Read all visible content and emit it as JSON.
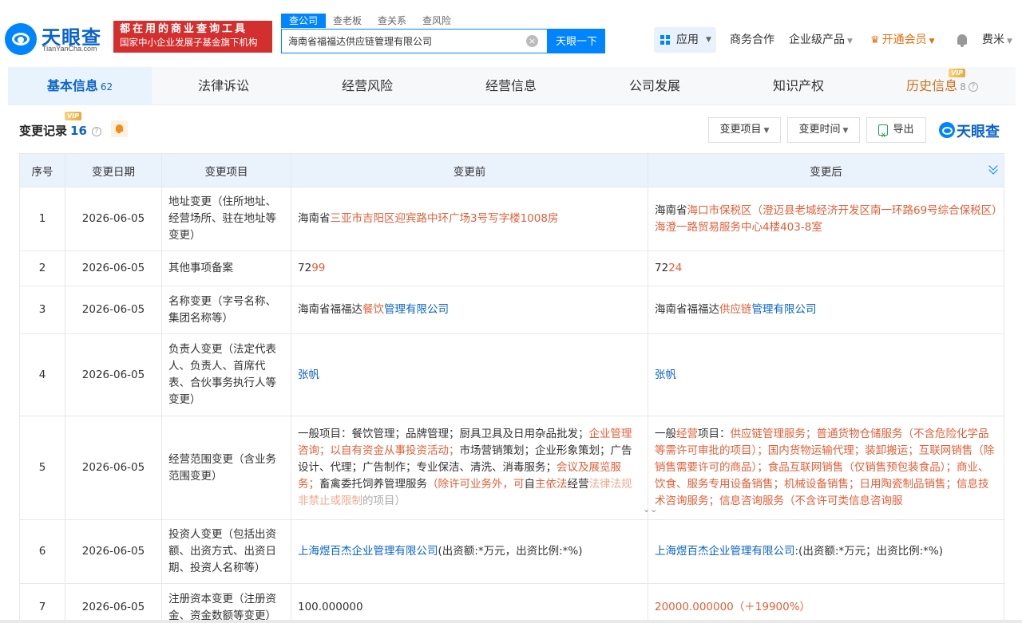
{
  "brand": {
    "name_cn": "天眼查",
    "name_en": "TianYanCha.com",
    "slogan_line1": "都在用的商业查询工具",
    "slogan_line2": "国家中小企业发展子基金旗下机构"
  },
  "search": {
    "tabs": [
      "查公司",
      "查老板",
      "查关系",
      "查风险"
    ],
    "active_tab": 0,
    "value": "海南省福福达供应链管理有限公司",
    "button": "天眼一下"
  },
  "nav": {
    "app": "应用",
    "cooperation": "商务合作",
    "enterprise": "企业级产品",
    "vip": "开通会员",
    "user": "费米"
  },
  "tabs": [
    {
      "label": "基本信息",
      "count": "62"
    },
    {
      "label": "法律诉讼",
      "count": ""
    },
    {
      "label": "经营风险",
      "count": ""
    },
    {
      "label": "经营信息",
      "count": ""
    },
    {
      "label": "公司发展",
      "count": ""
    },
    {
      "label": "知识产权",
      "count": ""
    },
    {
      "label": "历史信息",
      "count": "8"
    }
  ],
  "vip_label": "VIP",
  "section": {
    "title": "变更记录",
    "count": "16"
  },
  "filters": {
    "item": "变更项目",
    "time": "变更时间",
    "export": "导出"
  },
  "watermark": "天眼查",
  "table": {
    "headers": [
      "序号",
      "变更日期",
      "变更项目",
      "变更前",
      "变更后"
    ],
    "rows": [
      {
        "no": "1",
        "date": "2026-06-05",
        "item": "地址变更（住所地址、经营场所、驻在地址等变更）",
        "before": [
          [
            "海南省",
            ""
          ],
          [
            "三亚市吉阳区迎宾路中环广场3号写字楼1008房",
            "hl"
          ]
        ],
        "after": [
          [
            "海南省",
            ""
          ],
          [
            "海口市保税区（澄迈县老城经济开发区南一环路69号综合保税区）海澄一路贸易服务中心4楼403-8室",
            "hl"
          ]
        ]
      },
      {
        "no": "2",
        "date": "2026-06-05",
        "item": "其他事项备案",
        "before": [
          [
            "72",
            ""
          ],
          [
            "99",
            "hl"
          ]
        ],
        "after": [
          [
            "72",
            ""
          ],
          [
            "24",
            "hl"
          ]
        ]
      },
      {
        "no": "3",
        "date": "2026-06-05",
        "item": "名称变更（字号名称、集团名称等）",
        "before": [
          [
            "海南省福福达",
            ""
          ],
          [
            "餐饮",
            "hl"
          ],
          [
            "管理有限公司",
            "lk"
          ]
        ],
        "after": [
          [
            "海南省福福达",
            ""
          ],
          [
            "供应链",
            "hl"
          ],
          [
            "管理有限公司",
            "lk"
          ]
        ]
      },
      {
        "no": "4",
        "date": "2026-06-05",
        "item": "负责人变更（法定代表人、负责人、首席代表、合伙事务执行人等变更）",
        "before": [
          [
            "张帆",
            "lk"
          ]
        ],
        "after": [
          [
            "张帆",
            "lk"
          ]
        ]
      },
      {
        "no": "5",
        "date": "2026-06-05",
        "item": "经营范围变更（含业务范围变更）",
        "before": [
          [
            "一般项目：餐饮管理；品牌管理；厨具卫具及日用杂品批发；",
            ""
          ],
          [
            "企业管理咨询；以自有资金从事投资活动；",
            "hl"
          ],
          [
            "市场营销策划；企业形象策划；广告设计、代理；广告制作；专业保洁、清洗、消毒服务；",
            ""
          ],
          [
            "会议及展览服务；",
            "hl"
          ],
          [
            "畜禽委托饲养管理服务",
            ""
          ],
          [
            "（除许可业务外，可",
            "hl"
          ],
          [
            "自",
            ""
          ],
          [
            "主依法",
            "hl"
          ],
          [
            "经营",
            ""
          ],
          [
            "法律法规非禁止或限制",
            "fade"
          ],
          [
            "的项目）",
            "fadeg"
          ]
        ],
        "after": [
          [
            "一般",
            ""
          ],
          [
            "经营",
            "hl"
          ],
          [
            "项目：",
            ""
          ],
          [
            "供应链管理服务；普通货物仓储服务（不含危险化学品等需许可审批的项目）；国内货物运输代理；装卸搬运；互联网销售（除销售需要许可的商品）；食品互联网销售（仅销售预包装食品）；商业、饮食、服务专用设备销售；机械设备销售；日用陶瓷制品销售；信息技术咨询服务；信息咨询服务（不含许可类信息咨询服",
            "hl"
          ]
        ]
      },
      {
        "no": "6",
        "date": "2026-06-05",
        "item": "投资人变更（包括出资额、出资方式、出资日期、投资人名称等）",
        "before": [
          [
            "上海煜百杰企业管理有限公司",
            "lk"
          ],
          [
            "(出资额:*万元，出资比例:*%)",
            ""
          ]
        ],
        "after": [
          [
            "上海煜百杰企业管理有限公司",
            "lk"
          ],
          [
            ":(出资额:*万元；出资比例:*%)",
            ""
          ]
        ]
      },
      {
        "no": "7",
        "date": "2026-06-05",
        "item": "注册资本变更（注册资金、资金数额等变更）",
        "before": [
          [
            "100.000000",
            ""
          ]
        ],
        "after": [
          [
            "20000.000000（＋19900%）",
            "hl"
          ]
        ]
      }
    ]
  },
  "colors": {
    "brand_blue": "#0084ff",
    "link": "#0a63c9",
    "highlight": "#e0603a",
    "vip": "#e07010",
    "slogan_bg": "#d32f2f"
  },
  "icons": [
    "clear-icon",
    "apps-grid-icon",
    "crown-icon",
    "bell-icon",
    "question-icon",
    "excel-icon",
    "chevron-down-icon",
    "expand-more-icon"
  ]
}
